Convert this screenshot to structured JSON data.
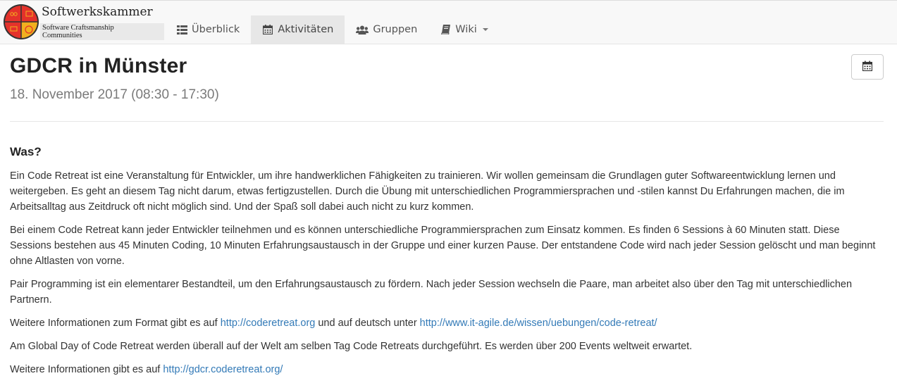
{
  "brand": {
    "name": "Softwerkskammer",
    "tagline_line1": "Software Craftsmanship",
    "tagline_line2": "Communities",
    "logo_colors": [
      "#e4322b",
      "#f2b01e",
      "#333333"
    ]
  },
  "nav": {
    "items": [
      {
        "label": "Überblick",
        "icon": "list-icon",
        "active": false
      },
      {
        "label": "Aktivitäten",
        "icon": "calendar-icon",
        "active": true
      },
      {
        "label": "Gruppen",
        "icon": "users-icon",
        "active": false
      },
      {
        "label": "Wiki",
        "icon": "book-icon",
        "active": false,
        "dropdown": true
      }
    ]
  },
  "page": {
    "title": "GDCR in Münster",
    "subtitle": "18. November 2017 (08:30 - 17:30)",
    "calendar_button_icon": "calendar-icon"
  },
  "section": {
    "title": "Was?",
    "p1": "Ein Code Retreat ist eine Veranstaltung für Entwickler, um ihre handwerklichen Fähigkeiten zu trainieren. Wir wollen gemeinsam die Grundlagen guter Softwareentwicklung lernen und weitergeben. Es geht an diesem Tag nicht darum, etwas fertigzustellen. Durch die Übung mit unterschiedlichen Programmiersprachen und -stilen kannst Du Erfahrungen machen, die im Arbeitsalltag aus Zeitdruck oft nicht möglich sind. Und der Spaß soll dabei auch nicht zu kurz kommen.",
    "p2": "Bei einem Code Retreat kann jeder Entwickler teilnehmen und es können unterschiedliche Programmiersprachen zum Einsatz kommen. Es finden 6 Sessions à 60 Minuten statt. Diese Sessions bestehen aus 45 Minuten Coding, 10 Minuten Erfahrungsaustausch in der Gruppe und einer kurzen Pause. Der entstandene Code wird nach jeder Session gelöscht und man beginnt ohne Altlasten von vorne.",
    "p3": "Pair Programming ist ein elementarer Bestandteil, um den Erfahrungsaustausch zu fördern. Nach jeder Session wechseln die Paare, man arbeitet also über den Tag mit unterschiedlichen Partnern.",
    "p4_prefix": "Weitere Informationen zum Format gibt es auf ",
    "p4_link1": "http://coderetreat.org",
    "p4_middle": " und auf deutsch unter ",
    "p4_link2": "http://www.it-agile.de/wissen/uebungen/code-retreat/",
    "p5": "Am Global Day of Code Retreat werden überall auf der Welt am selben Tag Code Retreats durchgeführt. Es werden über 200 Events weltweit erwartet.",
    "p6_prefix": "Weitere Informationen gibt es auf ",
    "p6_link": "http://gdcr.coderetreat.org/"
  },
  "colors": {
    "link": "#337ab7",
    "navbar_bg": "#f8f8f8",
    "nav_active_bg": "#e7e7e7"
  }
}
